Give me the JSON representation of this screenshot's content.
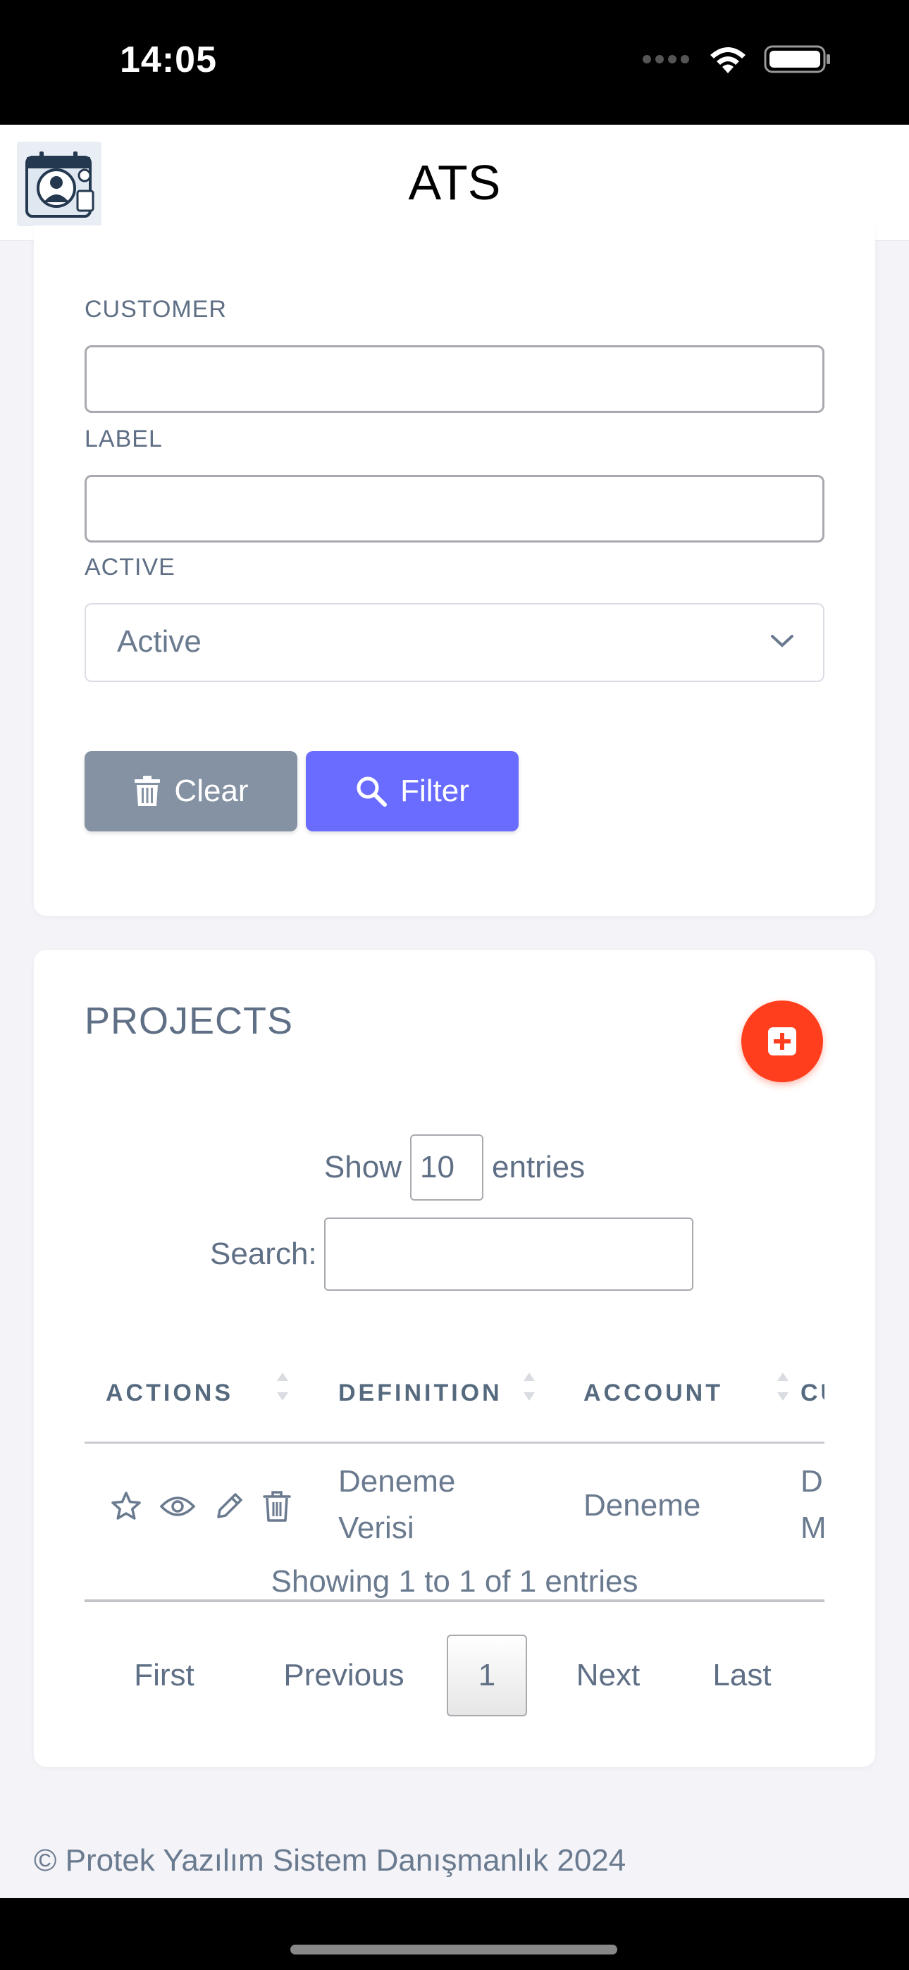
{
  "status": {
    "time": "14:05"
  },
  "app": {
    "title": "ATS"
  },
  "filter": {
    "customer_label": "CUSTOMER",
    "customer_value": "",
    "label_label": "LABEL",
    "label_value": "",
    "active_label": "ACTIVE",
    "active_value": "Active",
    "clear_label": "Clear",
    "filter_label": "Filter"
  },
  "projects": {
    "title": "PROJECTS",
    "show_prefix": "Show",
    "page_size": "10",
    "show_suffix": "entries",
    "search_label": "Search:",
    "search_value": "",
    "columns": [
      "ACTIONS",
      "DEFINITION",
      "ACCOUNT",
      "CU"
    ],
    "rows": [
      {
        "definition": [
          "Deneme",
          "Verisi"
        ],
        "account": "Deneme",
        "customer": [
          "D",
          "M"
        ]
      }
    ],
    "info": "Showing 1 to 1 of 1 entries",
    "pagination": {
      "first": "First",
      "previous": "Previous",
      "current": "1",
      "next": "Next",
      "last": "Last"
    }
  },
  "footer": {
    "text": "© Protek Yazılım Sistem Danışmanlık 2024"
  },
  "colors": {
    "primary": "#696cff",
    "secondary": "#8592a3",
    "danger": "#ff3e1d"
  },
  "icons": [
    "wifi-icon",
    "battery-icon",
    "signal-icon",
    "trash-icon",
    "search-icon",
    "plus-square-icon",
    "star-icon",
    "eye-icon",
    "pencil-icon",
    "chevron-down-icon",
    "sort-icon"
  ]
}
